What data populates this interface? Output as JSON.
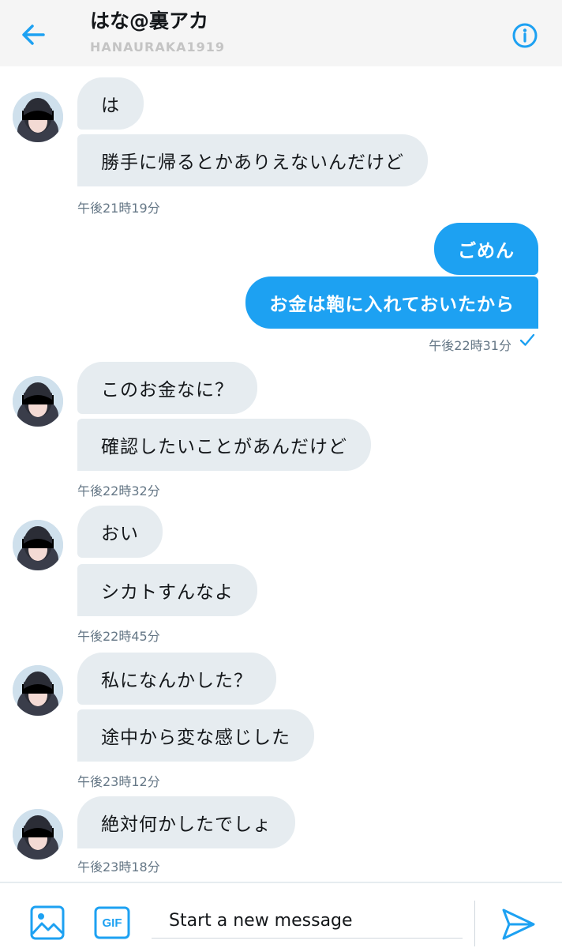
{
  "header": {
    "title": "はな@裏アカ",
    "handle": "HANAURAKA1919",
    "back_icon": "arrow-left-icon",
    "info_icon": "info-circle-icon"
  },
  "colors": {
    "accent": "#1da1f2",
    "incoming_bubble": "#e6ecf0",
    "header_bg": "#f5f5f5"
  },
  "messages": [
    {
      "direction": "incoming",
      "text": "は"
    },
    {
      "direction": "incoming",
      "text": "勝手に帰るとかありえないんだけど",
      "time": "午後21時19分"
    },
    {
      "direction": "outgoing",
      "text": "ごめん"
    },
    {
      "direction": "outgoing",
      "text": "お金は鞄に入れておいたから",
      "time": "午後22時31分",
      "status": "sent"
    },
    {
      "direction": "incoming",
      "text": "このお金なに？"
    },
    {
      "direction": "incoming",
      "text": "確認したいことがあんだけど",
      "time": "午後22時32分"
    },
    {
      "direction": "incoming",
      "text": "おい"
    },
    {
      "direction": "incoming",
      "text": "シカトすんなよ",
      "time": "午後22時45分"
    },
    {
      "direction": "incoming",
      "text": "私になんかした？"
    },
    {
      "direction": "incoming",
      "text": "途中から変な感じした",
      "time": "午後23時12分"
    },
    {
      "direction": "incoming",
      "text": "絶対何かしたでしょ",
      "time": "午後23時18分"
    }
  ],
  "composer": {
    "placeholder": "Start a new message",
    "media_icon": "image-icon",
    "gif_label": "GIF",
    "send_icon": "send-icon"
  }
}
